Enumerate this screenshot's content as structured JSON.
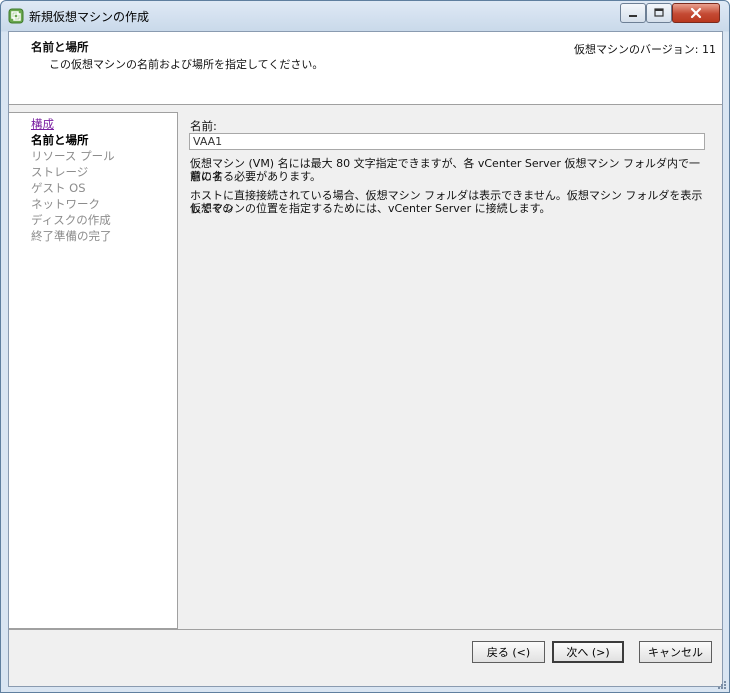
{
  "window": {
    "title": "新規仮想マシンの作成"
  },
  "header": {
    "title": "名前と場所",
    "description": "この仮想マシンの名前および場所を指定してください。",
    "version": "仮想マシンのバージョン: 11"
  },
  "nav": {
    "items": [
      {
        "label": "構成",
        "state": "link"
      },
      {
        "label": "名前と場所",
        "state": "current"
      },
      {
        "label": "リソース プール",
        "state": "disabled"
      },
      {
        "label": "ストレージ",
        "state": "disabled"
      },
      {
        "label": "ゲスト OS",
        "state": "disabled"
      },
      {
        "label": "ネットワーク",
        "state": "disabled"
      },
      {
        "label": "ディスクの作成",
        "state": "disabled"
      },
      {
        "label": "終了準備の完了",
        "state": "disabled"
      }
    ]
  },
  "form": {
    "name_label": "名前:",
    "name_value": "VAA1",
    "info_line1": "仮想マシン (VM) 名には最大 80 文字指定できますが、各 vCenter Server 仮想マシン フォルダ内で一意の名",
    "info_line2": "前にする必要があります。",
    "info_line3": "ホストに直接接続されている場合、仮想マシン フォルダは表示できません。仮想マシン フォルダを表示してその",
    "info_line4": "仮想マシンの位置を指定するためには、vCenter Server に接続します。"
  },
  "buttons": {
    "back": "戻る (<)",
    "next": "次へ (>)",
    "cancel": "キャンセル"
  },
  "colors": {
    "link": "#7a1fa2",
    "disabled": "#8c8c8c",
    "close_button": "#c44a33"
  }
}
